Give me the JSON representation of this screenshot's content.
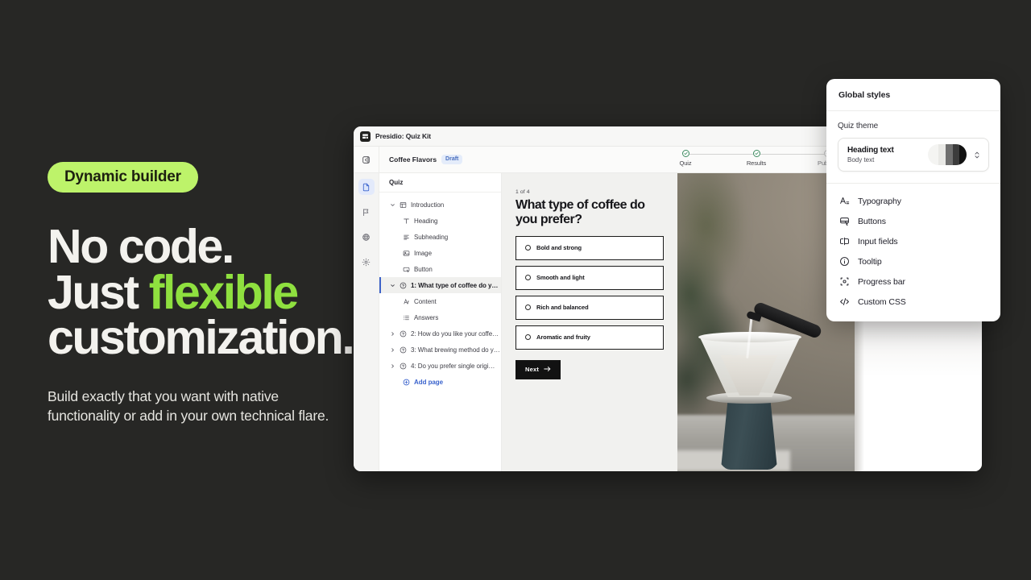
{
  "hero": {
    "badge": "Dynamic builder",
    "headline_line1": "No code.",
    "headline_line2_pre": "Just ",
    "headline_line2_accent": "flexible",
    "headline_line3": "customization.",
    "subcopy": "Build exactly that you want with native functionality or add in your own technical flare.",
    "accent_color": "#8fe03f",
    "badge_color": "#bdf36a",
    "background_color": "#272725"
  },
  "app": {
    "titlebar": {
      "app_name": "Presidio: Quiz Kit",
      "logo_icon": "app-logo-icon"
    },
    "toolbar": {
      "collapse_icon": "panel-collapse-icon",
      "document_name": "Coffee Flavors",
      "status_badge": "Draft",
      "steps": [
        {
          "label": "Quiz",
          "state": "complete"
        },
        {
          "label": "Results",
          "state": "complete"
        },
        {
          "label": "Publish",
          "state": "pending"
        }
      ]
    },
    "rail": [
      {
        "icon": "pages-icon",
        "active": true
      },
      {
        "icon": "flag-icon",
        "active": false
      },
      {
        "icon": "globe-icon",
        "active": false
      },
      {
        "icon": "gear-icon",
        "active": false
      }
    ],
    "tree": {
      "header": "Quiz",
      "items": [
        {
          "label": "Introduction",
          "icon": "layout-icon",
          "level": 0,
          "chevron": "down",
          "selected": false
        },
        {
          "label": "Heading",
          "icon": "text-heading-icon",
          "level": 1,
          "chevron": "none",
          "selected": false
        },
        {
          "label": "Subheading",
          "icon": "text-paragraph-icon",
          "level": 1,
          "chevron": "none",
          "selected": false
        },
        {
          "label": "Image",
          "icon": "image-icon",
          "level": 1,
          "chevron": "none",
          "selected": false
        },
        {
          "label": "Button",
          "icon": "button-icon",
          "level": 1,
          "chevron": "none",
          "selected": false
        },
        {
          "label": "1: What type of coffee do y…",
          "icon": "question-icon",
          "level": 0,
          "chevron": "down",
          "selected": true
        },
        {
          "label": "Content",
          "icon": "content-icon",
          "level": 1,
          "chevron": "none",
          "selected": false
        },
        {
          "label": "Answers",
          "icon": "list-icon",
          "level": 1,
          "chevron": "none",
          "selected": false
        },
        {
          "label": "2: How do you like your coffe…",
          "icon": "question-icon",
          "level": 0,
          "chevron": "right",
          "selected": false
        },
        {
          "label": "3: What brewing method do y…",
          "icon": "question-icon",
          "level": 0,
          "chevron": "right",
          "selected": false
        },
        {
          "label": "4: Do you prefer single origi…",
          "icon": "question-icon",
          "level": 0,
          "chevron": "right",
          "selected": false
        }
      ],
      "add_page_label": "Add page",
      "add_page_icon": "plus-circle-icon"
    },
    "canvas": {
      "counter": "1 of 4",
      "question": "What type of coffee do you prefer?",
      "answers": [
        "Bold and strong",
        "Smooth and light",
        "Rich and balanced",
        "Aromatic and fruity"
      ],
      "next_label": "Next",
      "next_icon": "arrow-right-icon"
    }
  },
  "global_styles": {
    "title": "Global styles",
    "section_label": "Quiz theme",
    "theme_card": {
      "heading_text": "Heading text",
      "body_text": "Body text",
      "swatch_colors": [
        "#f4f4f2",
        "#e9e9e6",
        "#6f6f6f",
        "#3c3c3c",
        "#111111"
      ],
      "stepper_icon": "chevron-up-down-icon"
    },
    "menu": [
      {
        "label": "Typography",
        "icon": "typography-icon"
      },
      {
        "label": "Buttons",
        "icon": "button-style-icon"
      },
      {
        "label": "Input fields",
        "icon": "input-field-icon"
      },
      {
        "label": "Tooltip",
        "icon": "info-circle-icon"
      },
      {
        "label": "Progress bar",
        "icon": "progress-bar-icon"
      },
      {
        "label": "Custom CSS",
        "icon": "code-icon"
      }
    ]
  }
}
